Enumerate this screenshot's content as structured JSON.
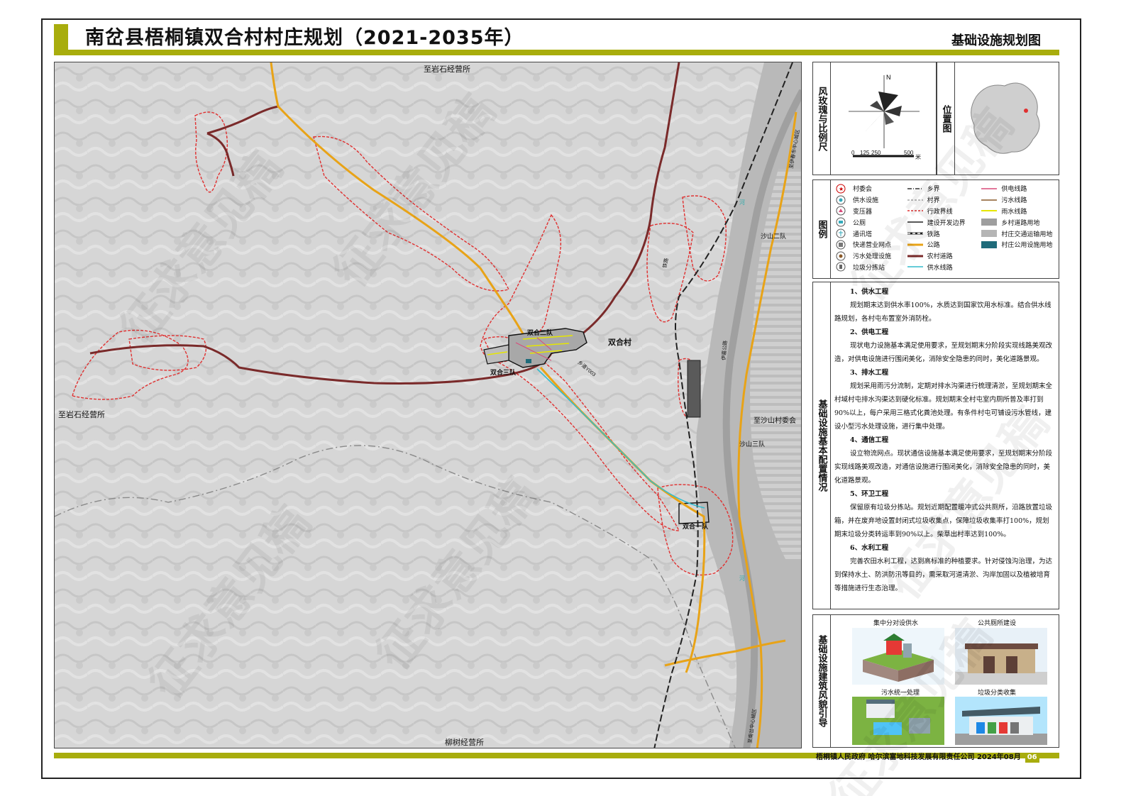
{
  "header": {
    "title": "南岔县梧桐镇双合村村庄规划（2021-2035年）",
    "subtitle": "基础设施规划图"
  },
  "map": {
    "labels": {
      "north_top": "至岩石经营所",
      "west": "至岩石经营所",
      "south": "柳树经营所",
      "shuanghe_village": "双合村",
      "team2": "双合二队",
      "team3": "双合三队",
      "team1": "双合一队",
      "shashan_team2": "沙山二队",
      "shashan_team3": "沙山三队",
      "to_shashan": "至沙山村委会",
      "road_y003": "乡道Y003",
      "railway": "铁路",
      "highway_e": "伊嘉公路",
      "highway_ne": "至伊春市中心城区",
      "highway_se": "至南岔中心城区",
      "river1": "河",
      "river2": "河"
    }
  },
  "rose_panel": {
    "label": "风玫瑰与比例尺",
    "north": "N",
    "scale_ticks": [
      "0",
      "125",
      "250",
      "500"
    ],
    "scale_unit": "米"
  },
  "location_panel": {
    "label": "位置图"
  },
  "legend": {
    "label": "图例",
    "items": [
      {
        "text": "村委会",
        "kind": "village-office"
      },
      {
        "text": "乡界",
        "kind": "township-boundary"
      },
      {
        "text": "供电线路",
        "kind": "power-line"
      },
      {
        "text": "供水设施",
        "kind": "water-facility"
      },
      {
        "text": "村界",
        "kind": "village-boundary"
      },
      {
        "text": "污水线路",
        "kind": "sewage-line"
      },
      {
        "text": "变压器",
        "kind": "transformer"
      },
      {
        "text": "行政界线",
        "kind": "admin-boundary"
      },
      {
        "text": "雨水线路",
        "kind": "rain-line"
      },
      {
        "text": "公厕",
        "kind": "toilet"
      },
      {
        "text": "建设开发边界",
        "kind": "development-boundary"
      },
      {
        "text": "乡村道路用地",
        "kind": "rural-road-land"
      },
      {
        "text": "通讯塔",
        "kind": "comm-tower"
      },
      {
        "text": "铁路",
        "kind": "railway"
      },
      {
        "text": "村庄交通运输用地",
        "kind": "transport-land"
      },
      {
        "text": "快递营业网点",
        "kind": "express-point"
      },
      {
        "text": "公路",
        "kind": "highway"
      },
      {
        "text": "村庄公用设施用地",
        "kind": "utility-land"
      },
      {
        "text": "污水处理设施",
        "kind": "sewage-facility"
      },
      {
        "text": "农村道路",
        "kind": "rural-road"
      },
      {
        "text": "",
        "kind": "empty"
      },
      {
        "text": "垃圾分拣站",
        "kind": "garbage-station"
      },
      {
        "text": "供水线路",
        "kind": "water-line"
      },
      {
        "text": "",
        "kind": "empty"
      }
    ]
  },
  "notes": {
    "label": "基础设施基本配置情况",
    "sections": [
      {
        "heading": "1、供水工程",
        "body": "规划期末达到供水率100%，水质达到国家饮用水标准。结合供水线路规划，各村屯布置室外消防栓。"
      },
      {
        "heading": "2、供电工程",
        "body": "现状电力设施基本满足使用要求，至规划期末分阶段实现线路美观改造，对供电设施进行围闭美化，消除安全隐患的同时，美化道路景观。"
      },
      {
        "heading": "3、排水工程",
        "body": "规划采用雨污分流制，定期对排水沟渠进行梳理清淤，至规划期末全村域村屯排水沟渠达到硬化标准。规划期末全村屯室内厕所普及率打到90%以上，每户采用三格式化粪池处理。有条件村屯可铺设污水管线，建设小型污水处理设施，进行集中处理。"
      },
      {
        "heading": "4、通信工程",
        "body": "设立物流网点。现状通信设施基本满足使用要求，至规划期末分阶段实现线路美观改造，对通信设施进行围闭美化，消除安全隐患的同时，美化道路景观。"
      },
      {
        "heading": "5、环卫工程",
        "body": "保留原有垃圾分拣站。规划近期配置暖冲式公共厕所，沿路放置垃圾箱，并在废弃地设置封闭式垃圾收集点，保障垃圾收集率打100%，规划期末垃圾分类转运率到90%以上。柴草出村率达到100%。"
      },
      {
        "heading": "6、水利工程",
        "body": "完善农田水利工程，达到高标准的种植要求。针对侵蚀沟治理，为达到保持水土、防洪防汛等目的，需采取河道清淤、沟岸加固以及植被培育等措施进行生态治理。"
      }
    ]
  },
  "guide": {
    "label": "基础设施建筑风貌引导",
    "captions": [
      "集中分对设供水",
      "公共厕所建设",
      "污水统一处理",
      "垃圾分类收集"
    ]
  },
  "footer": {
    "text": "梧桐镇人民政府  哈尔滨富地科技发展有限责任公司  2024年08月",
    "page": "06"
  },
  "watermark": "征求意见稿",
  "colors": {
    "accent": "#a8ad0d",
    "rural_road": "#7a2a2a",
    "highway": "#e8a317",
    "admin_boundary": "#e03030",
    "water_line": "#33bbcc",
    "rain_line": "#e6e600",
    "power_line": "#d94a7a",
    "sewage_line": "#8a5a2a"
  }
}
